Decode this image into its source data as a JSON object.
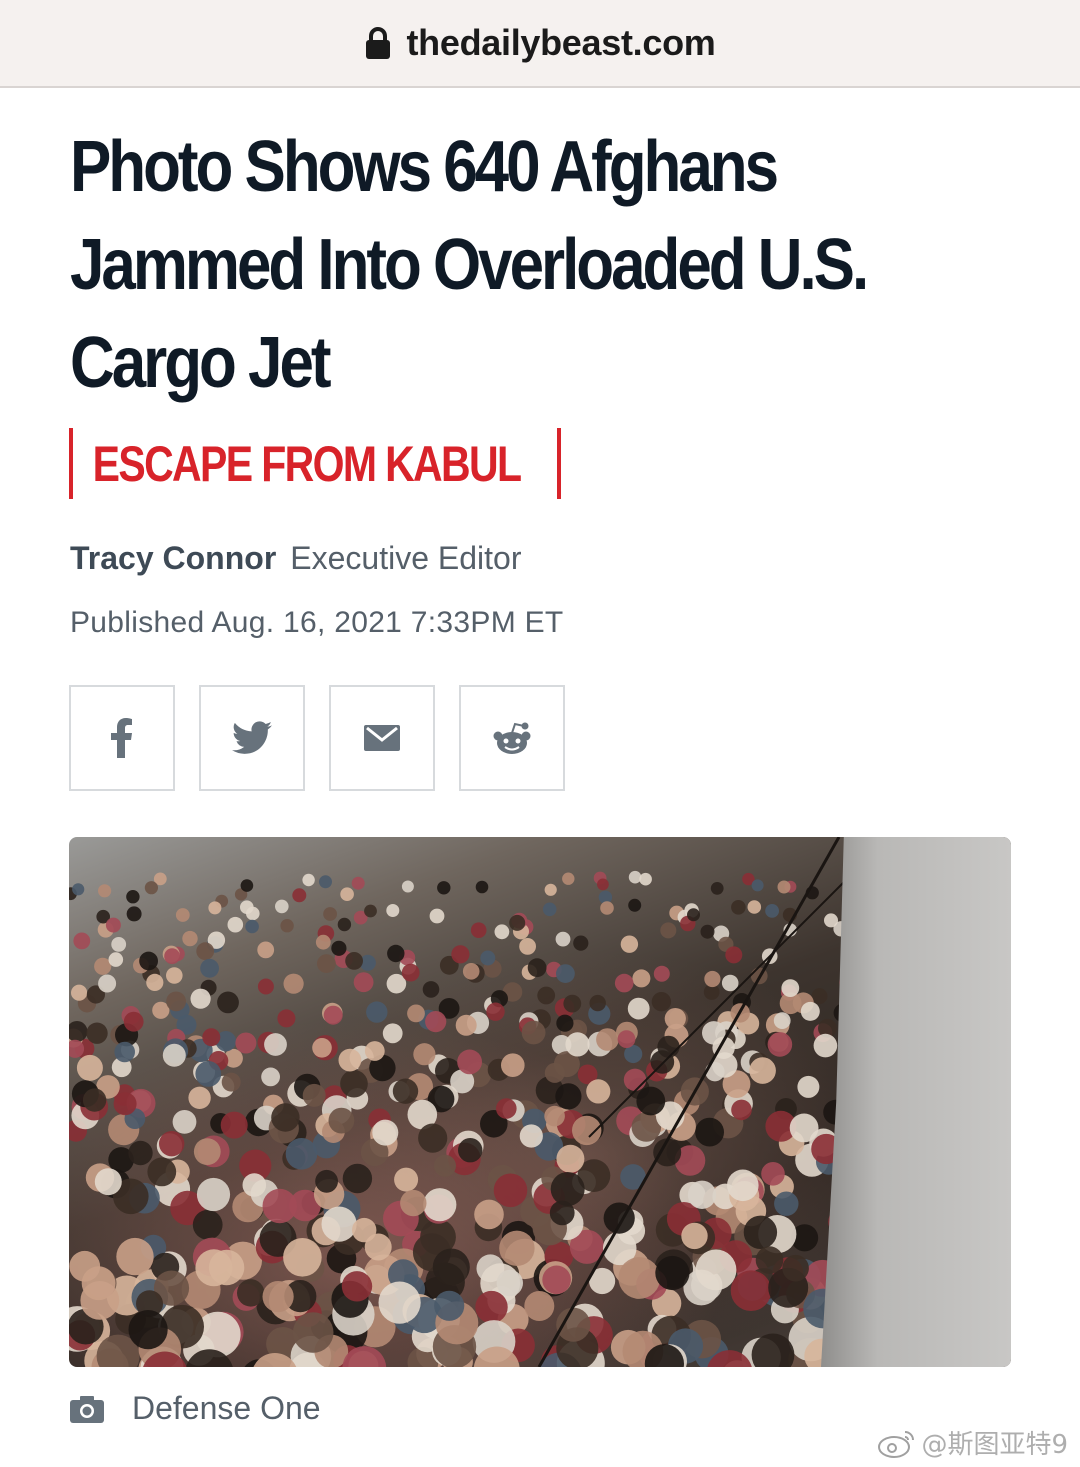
{
  "browser": {
    "url": "thedailybeast.com",
    "lock_icon": "lock-icon"
  },
  "article": {
    "headline": "Photo Shows 640 Afghans Jammed Into Overloaded U.S. Cargo Jet",
    "kicker": "ESCAPE FROM KABUL",
    "author": "Tracy Connor",
    "author_role": "Executive Editor",
    "published": "Published Aug. 16, 2021 7:33PM ET",
    "photo_credit": "Defense One"
  },
  "share_buttons": [
    {
      "name": "facebook",
      "icon": "facebook-icon"
    },
    {
      "name": "twitter",
      "icon": "twitter-icon"
    },
    {
      "name": "email",
      "icon": "mail-icon"
    },
    {
      "name": "reddit",
      "icon": "reddit-icon"
    }
  ],
  "watermark": {
    "text": "@斯图亚特9"
  },
  "colors": {
    "kicker_red": "#d8232a",
    "headline": "#0f1a26",
    "meta_gray": "#555f69"
  }
}
